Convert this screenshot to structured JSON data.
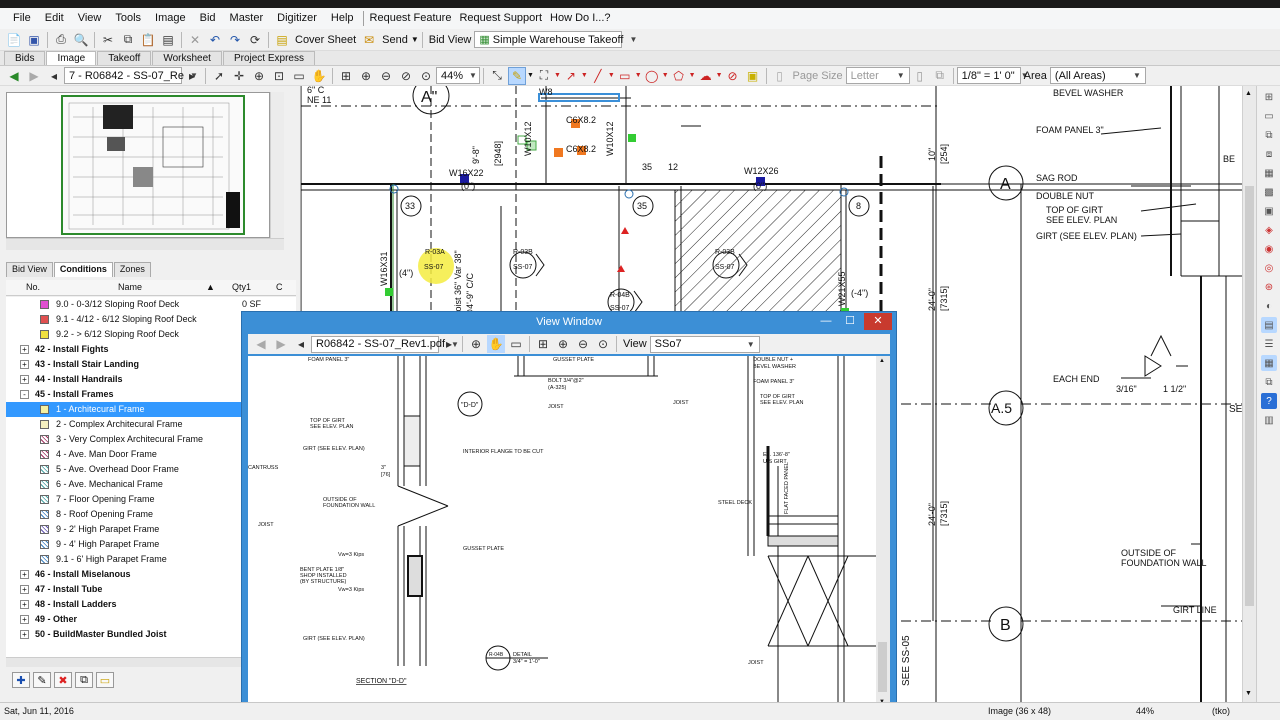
{
  "menu": [
    "File",
    "Edit",
    "View",
    "Tools",
    "Image",
    "Bid",
    "Master",
    "Digitizer",
    "Help",
    "Request Feature",
    "Request Support",
    "How Do I...?"
  ],
  "toolbar1": {
    "cover_sheet": "Cover Sheet",
    "send": "Send",
    "bid_view_label": "Bid View",
    "bid_view_value": "Simple Warehouse Takeoff"
  },
  "tabs": [
    "Bids",
    "Image",
    "Takeoff",
    "Worksheet",
    "Project Express"
  ],
  "toolbar2": {
    "page_select": "7 - R06842 - SS-07_Re",
    "zoom": "44%",
    "page_size_label": "Page Size",
    "page_size_value": "Letter",
    "scale": "1/8\" = 1' 0\"",
    "area_label": "Area",
    "area_value": "(All Areas)"
  },
  "panel_tabs": [
    "Bid View",
    "Conditions",
    "Zones"
  ],
  "grid_headers": {
    "no": "No.",
    "name": "Name",
    "qty": "Qty1",
    "c": "C"
  },
  "conditions": [
    {
      "type": "item",
      "text": "9.0 - 0-3/12 Sloping Roof Deck",
      "swatch": "#e04fd0",
      "qty": "0 SF"
    },
    {
      "type": "item",
      "text": "9.1 - 4/12 - 6/12 Sloping Roof Deck",
      "swatch": "#e05050",
      "qty": ""
    },
    {
      "type": "item",
      "text": "9.2 - > 6/12 Sloping Roof Deck",
      "swatch": "#f0e040",
      "qty": ""
    },
    {
      "type": "group",
      "text": "42 - Install Fights",
      "exp": "+"
    },
    {
      "type": "group",
      "text": "43 - Install Stair Landing",
      "exp": "+"
    },
    {
      "type": "group",
      "text": "44 - Install Handrails",
      "exp": "+"
    },
    {
      "type": "group",
      "text": "45 - Install Frames",
      "exp": "-"
    },
    {
      "type": "item",
      "text": "1 - Architecural Frame",
      "swatch": "#f5f0a0",
      "selected": true
    },
    {
      "type": "item",
      "text": "2 - Complex  Architecural Frame",
      "swatch": "#f5f0c0"
    },
    {
      "type": "item",
      "text": "3 - Very Complex Architecural Frame",
      "hatch": "hatch"
    },
    {
      "type": "item",
      "text": "4 - Ave. Man Door Frame",
      "hatch": "hatch"
    },
    {
      "type": "item",
      "text": "5 - Ave. Overhead Door Frame",
      "hatch": "hatch3"
    },
    {
      "type": "item",
      "text": "6 - Ave. Mechanical Frame",
      "hatch": "hatch3"
    },
    {
      "type": "item",
      "text": "7 - Floor Opening Frame",
      "hatch": "hatch3"
    },
    {
      "type": "item",
      "text": "8 - Roof Opening Frame",
      "hatch": "hatch2"
    },
    {
      "type": "item",
      "text": "9 - 2' High Parapet Frame",
      "hatch": "hatch4"
    },
    {
      "type": "item",
      "text": "9 - 4' High Parapet Frame",
      "hatch": "hatch2"
    },
    {
      "type": "item",
      "text": "9.1 - 6' High Parapet Frame",
      "hatch": "hatch2"
    },
    {
      "type": "group",
      "text": "46 - Install Miselanous",
      "exp": "+"
    },
    {
      "type": "group",
      "text": "47 - Install Tube",
      "exp": "+"
    },
    {
      "type": "group",
      "text": "48 - Install Ladders",
      "exp": "+"
    },
    {
      "type": "group",
      "text": "49 - Other",
      "exp": "+"
    },
    {
      "type": "group",
      "text": "50 - BuildMaster Bundled Joist",
      "exp": "+"
    }
  ],
  "view_window": {
    "title": "View Window",
    "file": "R06842 - SS-07_Rev1.pdf",
    "view_label": "View",
    "view_value": "SSo7"
  },
  "status": {
    "date": "Sat, Jun 11, 2016",
    "image_size": "Image (36 x 48)",
    "zoom": "44%",
    "user": "(tko)"
  },
  "drawing_labels": {
    "bevel_washer": "BEVEL WASHER",
    "foam_panel": "FOAM PANEL 3\"",
    "sag_rod": "SAG ROD",
    "double_nut": "DOUBLE NUT",
    "top_of_girt": "TOP OF GIRT",
    "see_elev": "SEE ELEV. PLAN",
    "girt": "GIRT (SEE ELEV. PLAN)",
    "each_end": "EACH END",
    "outside": "OUTSIDE OF",
    "foundation_wall": "FOUNDATION WALL",
    "girt_line": "GIRT LINE",
    "grid_a": "A",
    "grid_a5": "A.5",
    "grid_b": "B",
    "grid_a_top": "A\"",
    "dim_24": "24'-0\"",
    "dim_7315": "[7315]",
    "see_ss05": "SEE SS-05",
    "sec": "SEC",
    "w8": "W8",
    "c6x82a": "C6X8.2",
    "c6x82b": "C6X8.2",
    "w10x12": "W10X12",
    "w12x26": "W12X26",
    "w16x22": "W16X22",
    "n35a": "35",
    "n35b": "35",
    "n12": "12",
    "n33": "33",
    "n8": "8",
    "r03a": "R-03A",
    "ss07a": "SS-07",
    "r03b": "R-03B",
    "ss07b": "SS-07",
    "r03b2": "R-03B",
    "ss07c": "SS-07",
    "r04b": "R-04B",
    "ss07d": "SS-07",
    "joist": "Joist 36\" Var 38\"",
    "joist2": "@4'-9\" C/C",
    "zero1": "(0\")",
    "zero2": "(0\")",
    "four1": "(4\")",
    "four2": "(-4\")",
    "dim_2948": "[2948]",
    "dim_98": "9'-8\"",
    "dim_10": "10\"",
    "dim_254": "[254]",
    "w16x31": "W16X31",
    "w21x55": "W21X55",
    "dim_316": "3/16\"",
    "dim_112": "1 1/2\"",
    "b_mark": "BE",
    "dim_6": "6\" C",
    "ne11": "NE 11"
  },
  "view_labels": {
    "foam": "FOAM PANEL 3\"",
    "gusset_top": "GUSSET PLATE",
    "bolt": "BOLT 3/4\"@2\"",
    "a325": "(A-325)",
    "joist1": "JOIST",
    "joist2": "JOIST",
    "joist3": "JOIST",
    "joist4": "JOIST",
    "dd": "\"D-D\"",
    "dn_bevel1": "DOUBLE NUT +",
    "dn_bevel2": "BEVEL WASHER",
    "foam2": "FOAM PANEL 3\"",
    "top_of_girt": "TOP OF GIRT",
    "see_elev": "SEE ELEV. PLAN",
    "top_of_girt2": "TOP OF GIRT",
    "see_elev2": "SEE ELEV. PLAN",
    "girt1": "GIRT (SEE ELEV. PLAN)",
    "flange": "INTERIOR FLANGE TO BE CUT",
    "el": "EL. 136'-8\"",
    "us_girt": "U/S GIRT",
    "cantruss": "CANTRUSS",
    "outside": "OUTSIDE OF",
    "foundation": "FOUNDATION WALL",
    "steel_deck": "STEEL DECK",
    "flat_panel": "FLAT FACED PANEL",
    "three": "3\"",
    "seventy6": "[76]",
    "gusset": "GUSSET PLATE",
    "vw3": "Vw=3 Kips",
    "vw3b": "Vw=3 Kips",
    "bent1": "BENT PLATE 1/8\"",
    "bent2": "SHOP INSTALLED",
    "bent3": "(BY STRUCTURE)",
    "girt2": "GIRT (SEE ELEV. PLAN)",
    "section": "SECTION \"D-D\"",
    "r04b": "R-04B",
    "detail": "DETAIL",
    "scale": "3/4\" = 1'-0\""
  }
}
